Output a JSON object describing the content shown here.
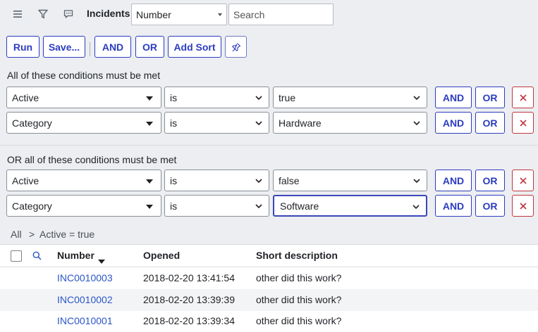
{
  "header": {
    "title": "Incidents",
    "field_select": "Number",
    "search_placeholder": "Search"
  },
  "toolbar": {
    "run": "Run",
    "save": "Save...",
    "and": "AND",
    "or": "OR",
    "add_sort": "Add Sort"
  },
  "groups": [
    {
      "label": "All of these conditions must be met",
      "conditions": [
        {
          "field": "Active",
          "operator": "is",
          "value": "true",
          "and": "AND",
          "or": "OR"
        },
        {
          "field": "Category",
          "operator": "is",
          "value": "Hardware",
          "and": "AND",
          "or": "OR"
        }
      ]
    },
    {
      "label": "OR all of these conditions must be met",
      "conditions": [
        {
          "field": "Active",
          "operator": "is",
          "value": "false",
          "and": "AND",
          "or": "OR"
        },
        {
          "field": "Category",
          "operator": "is",
          "value": "Software",
          "and": "AND",
          "or": "OR"
        }
      ]
    }
  ],
  "breadcrumb": {
    "all": "All",
    "separator": ">",
    "current": "Active = true"
  },
  "table": {
    "columns": [
      "Number",
      "Opened",
      "Short description"
    ],
    "rows": [
      {
        "number": "INC0010003",
        "opened": "2018-02-20 13:41:54",
        "description": "other did this work?"
      },
      {
        "number": "INC0010002",
        "opened": "2018-02-20 13:39:39",
        "description": "other did this work?"
      },
      {
        "number": "INC0010001",
        "opened": "2018-02-20 13:39:34",
        "description": "other did this work?"
      }
    ]
  },
  "colors": {
    "accent": "#2c3cbf",
    "danger": "#c0363e",
    "link": "#2b56c7",
    "panel_bg": "#eceef1"
  }
}
